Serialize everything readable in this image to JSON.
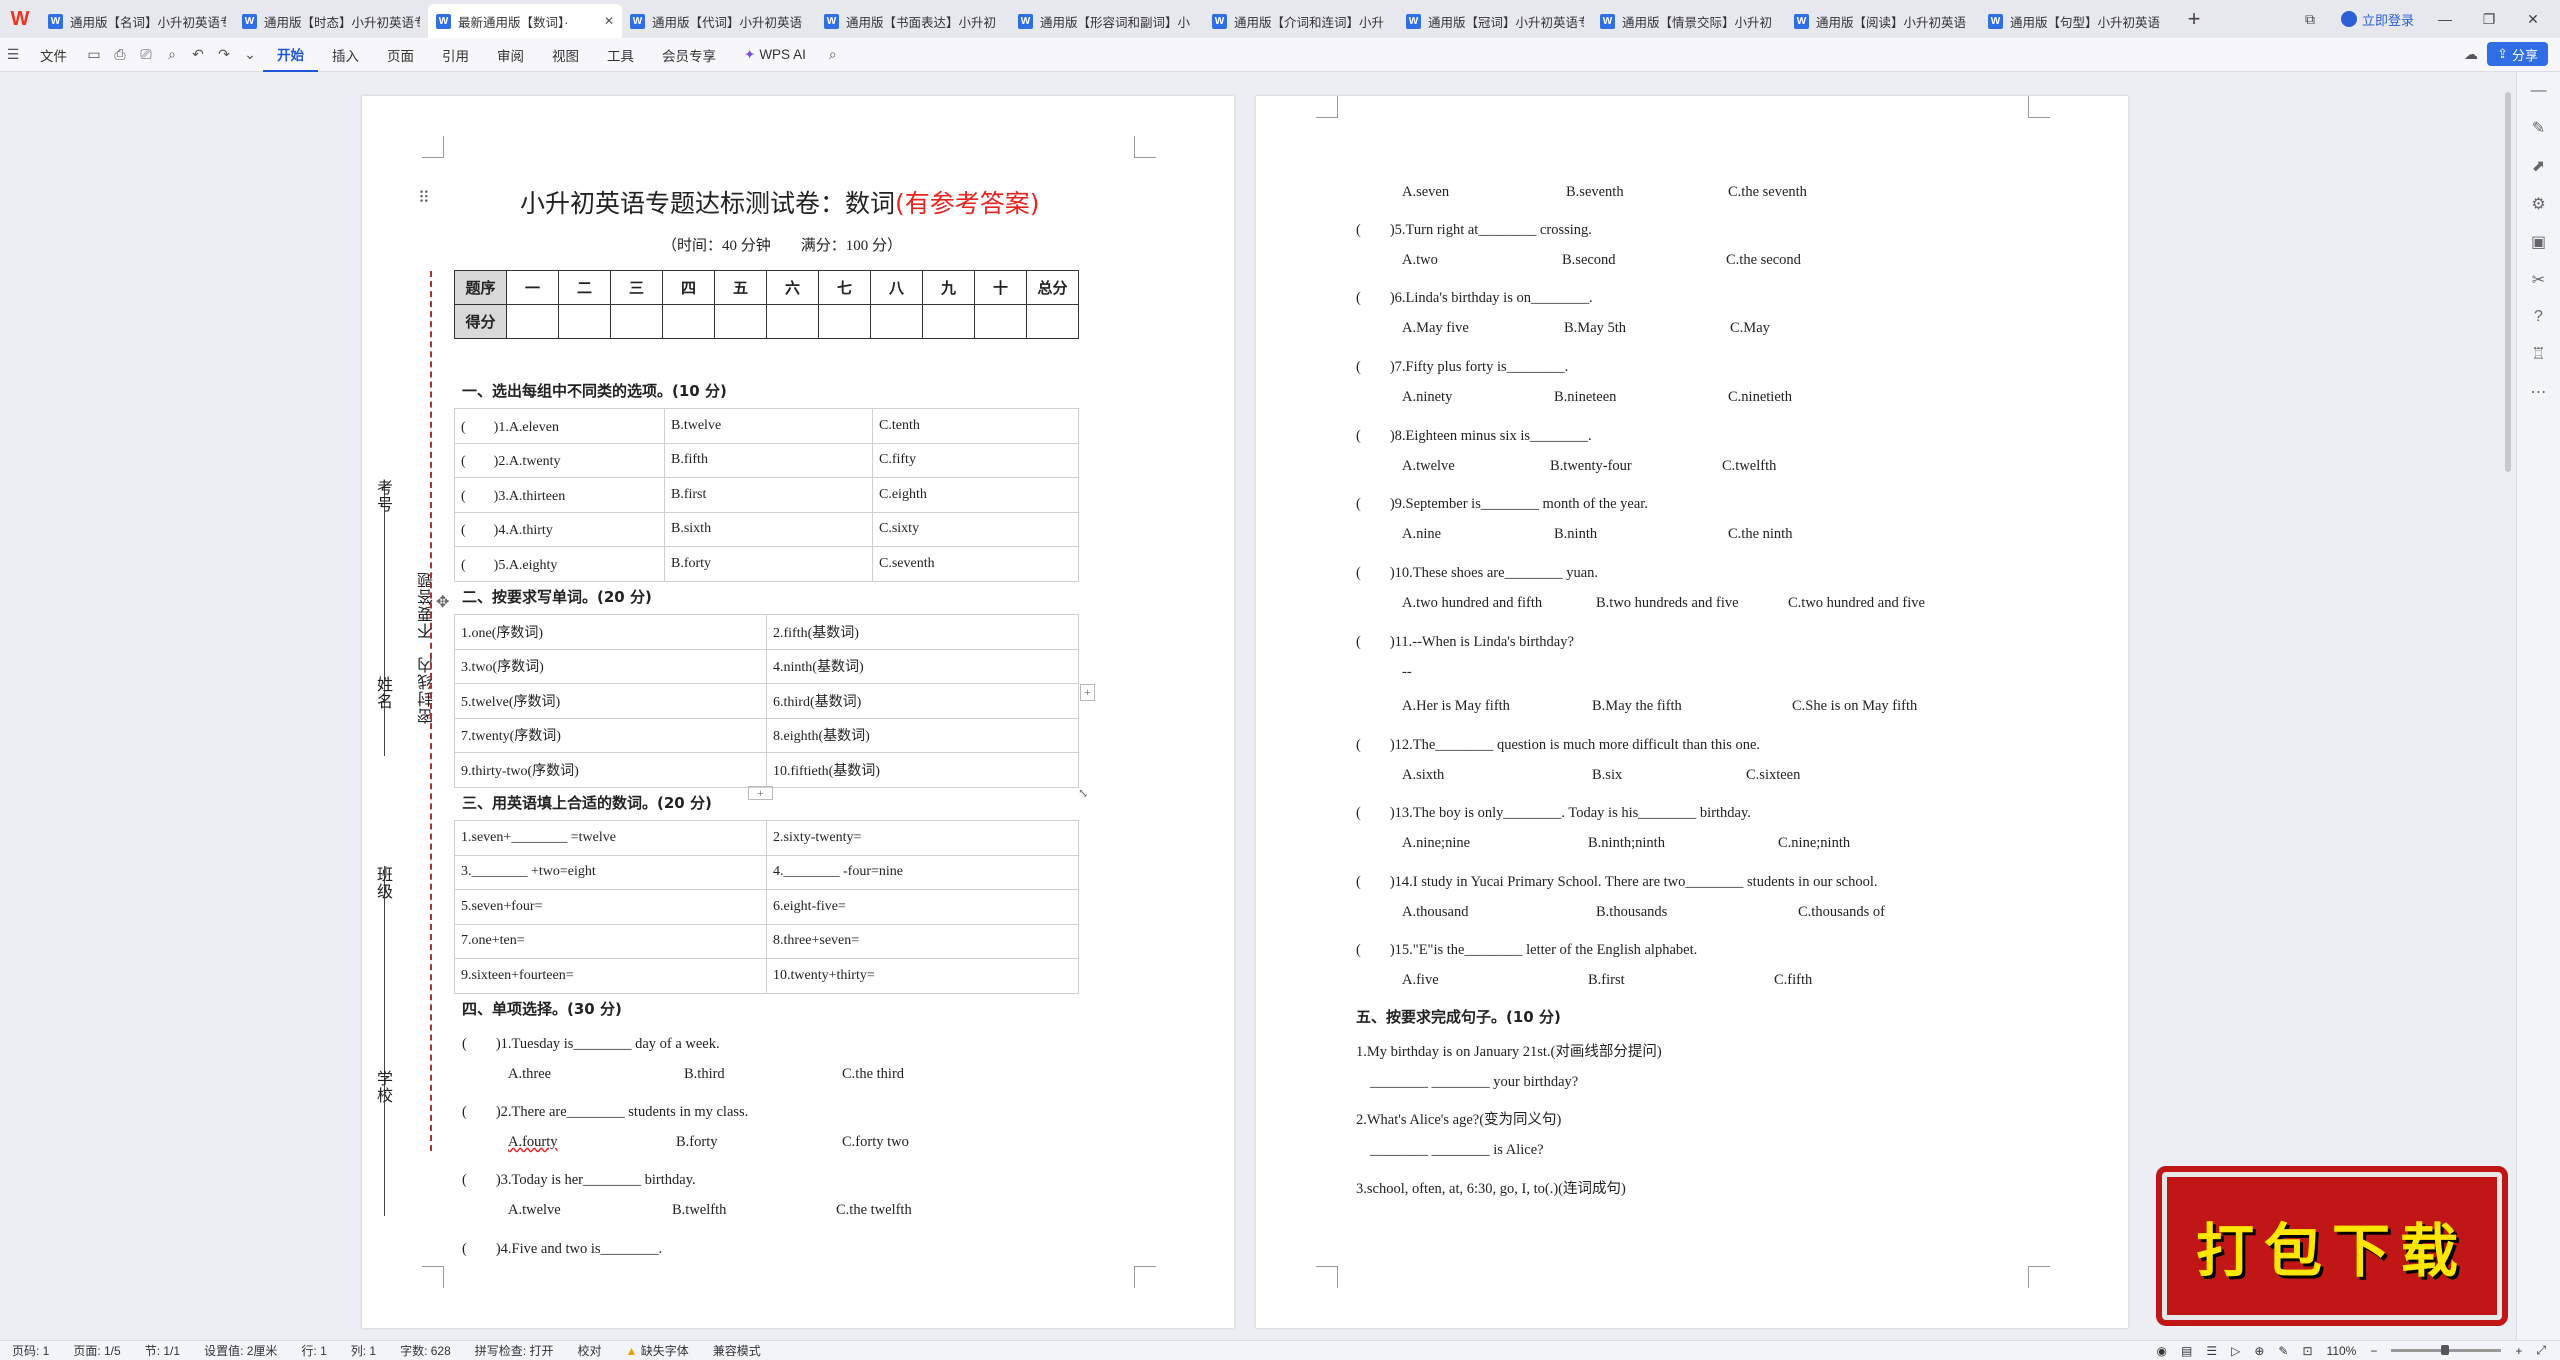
{
  "tabs": [
    "通用版【名词】小升初英语专",
    "通用版【时态】小升初英语专",
    "最新通用版【数词】·",
    "通用版【代词】小升初英语",
    "通用版【书面表达】小升初",
    "通用版【形容词和副词】小",
    "通用版【介词和连词】小升",
    "通用版【冠词】小升初英语专",
    "通用版【情景交际】小升初",
    "通用版【阅读】小升初英语",
    "通用版【句型】小升初英语"
  ],
  "tab_icon": "W",
  "login_label": "立即登录",
  "ribbon": {
    "file": "文件",
    "tabs": [
      "开始",
      "插入",
      "页面",
      "引用",
      "审阅",
      "视图",
      "工具",
      "会员专享"
    ],
    "ai": "WPS AI",
    "share": "分享"
  },
  "doc": {
    "title_main": "小升初英语专题达标测试卷：数词",
    "title_red": "(有参考答案)",
    "subtitle": "（时间：40 分钟　　满分：100 分）",
    "score_table": {
      "row1": [
        "题序",
        "一",
        "二",
        "三",
        "四",
        "五",
        "六",
        "七",
        "八",
        "九",
        "十",
        "总分"
      ],
      "row2": [
        "得分"
      ]
    },
    "side_labels": {
      "kaohao": "考号",
      "xingming": "姓名",
      "banji": "班级",
      "xuexiao": "学校",
      "warning": "密封线内　不要答题"
    },
    "sec1": {
      "heading": "一、选出每组中不同类的选项。(10 分)",
      "rows": [
        [
          "(　　)1.A.eleven",
          "B.twelve",
          "C.tenth"
        ],
        [
          "(　　)2.A.twenty",
          "B.fifth",
          "C.fifty"
        ],
        [
          "(　　)3.A.thirteen",
          "B.first",
          "C.eighth"
        ],
        [
          "(　　)4.A.thirty",
          "B.sixth",
          "C.sixty"
        ],
        [
          "(　　)5.A.eighty",
          "B.forty",
          "C.seventh"
        ]
      ]
    },
    "sec2": {
      "heading": "二、按要求写单词。(20 分)",
      "rows": [
        [
          "1.one(序数词)",
          "2.fifth(基数词)"
        ],
        [
          "3.two(序数词)",
          "4.ninth(基数词)"
        ],
        [
          "5.twelve(序数词)",
          "6.third(基数词)"
        ],
        [
          "7.twenty(序数词)",
          "8.eighth(基数词)"
        ],
        [
          "9.thirty-two(序数词)",
          "10.fiftieth(基数词)"
        ]
      ]
    },
    "sec3": {
      "heading": "三、用英语填上合适的数词。(20 分)",
      "rows": [
        [
          "1.seven+________ =twelve",
          "2.sixty-twenty="
        ],
        [
          "3.________ +two=eight",
          "4.________ -four=nine"
        ],
        [
          "5.seven+four=",
          "6.eight-five="
        ],
        [
          "7.one+ten=",
          "8.three+seven="
        ],
        [
          "9.sixteen+fourteen=",
          "10.twenty+thirty="
        ]
      ]
    },
    "sec4": {
      "heading": "四、单项选择。(30 分)",
      "q1": "(　　)1.Tuesday is________ day of a week.",
      "q1_opts": [
        "A.three",
        "B.third",
        "C.the third"
      ],
      "q2": "(　　)2.There are________ students in my class.",
      "q2_opts": [
        "A.fourty",
        "B.forty",
        "C.forty two"
      ],
      "q3": "(　　)3.Today is her________ birthday.",
      "q3_opts": [
        "A.twelve",
        "B.twelfth",
        "C.the twelfth"
      ],
      "q4": "(　　)4.Five and two is________."
    },
    "p2": {
      "q4_opts": [
        "A.seven",
        "B.seventh",
        "C.the seventh"
      ],
      "q5": "(　　)5.Turn right at________ crossing.",
      "q5_opts": [
        "A.two",
        "B.second",
        "C.the second"
      ],
      "q6": "(　　)6.Linda's birthday is on________.",
      "q6_opts": [
        "A.May five",
        "B.May 5th",
        "C.May"
      ],
      "q7": "(　　)7.Fifty plus forty is________.",
      "q7_opts": [
        "A.ninety",
        "B.nineteen",
        "C.ninetieth"
      ],
      "q8": "(　　)8.Eighteen minus six is________.",
      "q8_opts": [
        "A.twelve",
        "B.twenty-four",
        "C.twelfth"
      ],
      "q9": "(　　)9.September is________ month of the year.",
      "q9_opts": [
        "A.nine",
        "B.ninth",
        "C.the ninth"
      ],
      "q10": "(　　)10.These shoes are________ yuan.",
      "q10_opts": [
        "A.two hundred and fifth",
        "B.two hundreds and five",
        "C.two hundred and five"
      ],
      "q11": "(　　)11.--When is Linda's birthday?",
      "q11_b": "--",
      "q11_opts": [
        "A.Her is May fifth",
        "B.May the fifth",
        "C.She is on May fifth"
      ],
      "q12": "(　　)12.The________ question is much more difficult than this one.",
      "q12_opts": [
        "A.sixth",
        "B.six",
        "C.sixteen"
      ],
      "q13": "(　　)13.The boy is only________. Today is his________ birthday.",
      "q13_opts": [
        "A.nine;nine",
        "B.ninth;ninth",
        "C.nine;ninth"
      ],
      "q14": "(　　)14.I study in Yucai Primary School. There are two________ students in our school.",
      "q14_opts": [
        "A.thousand",
        "B.thousands",
        "C.thousands of"
      ],
      "q15": "(　　)15.\"E\"is the________ letter of the English alphabet.",
      "q15_opts": [
        "A.five",
        "B.first",
        "C.fifth"
      ],
      "sec5_heading": "五、按要求完成句子。(10 分)",
      "s1": "1.My birthday is on January 21st.(对画线部分提问)",
      "s1_ans": "________ ________ your birthday?",
      "s2": "2.What's Alice's age?(变为同义句)",
      "s2_ans": "________ ________ is Alice?",
      "s3": "3.school, often, at, 6:30, go, I, to(.)(连词成句)"
    }
  },
  "status": {
    "page": "页码: 1",
    "pages": "页面: 1/5",
    "section": "节: 1/1",
    "setting": "设置值: 2厘米",
    "row": "行: 1",
    "col": "列: 1",
    "words": "字数: 628",
    "spell": "拼写检查: 打开",
    "proof": "校对",
    "missing_font": "缺失字体",
    "compat": "兼容模式",
    "zoom": "110%"
  },
  "banner": "打包下载"
}
